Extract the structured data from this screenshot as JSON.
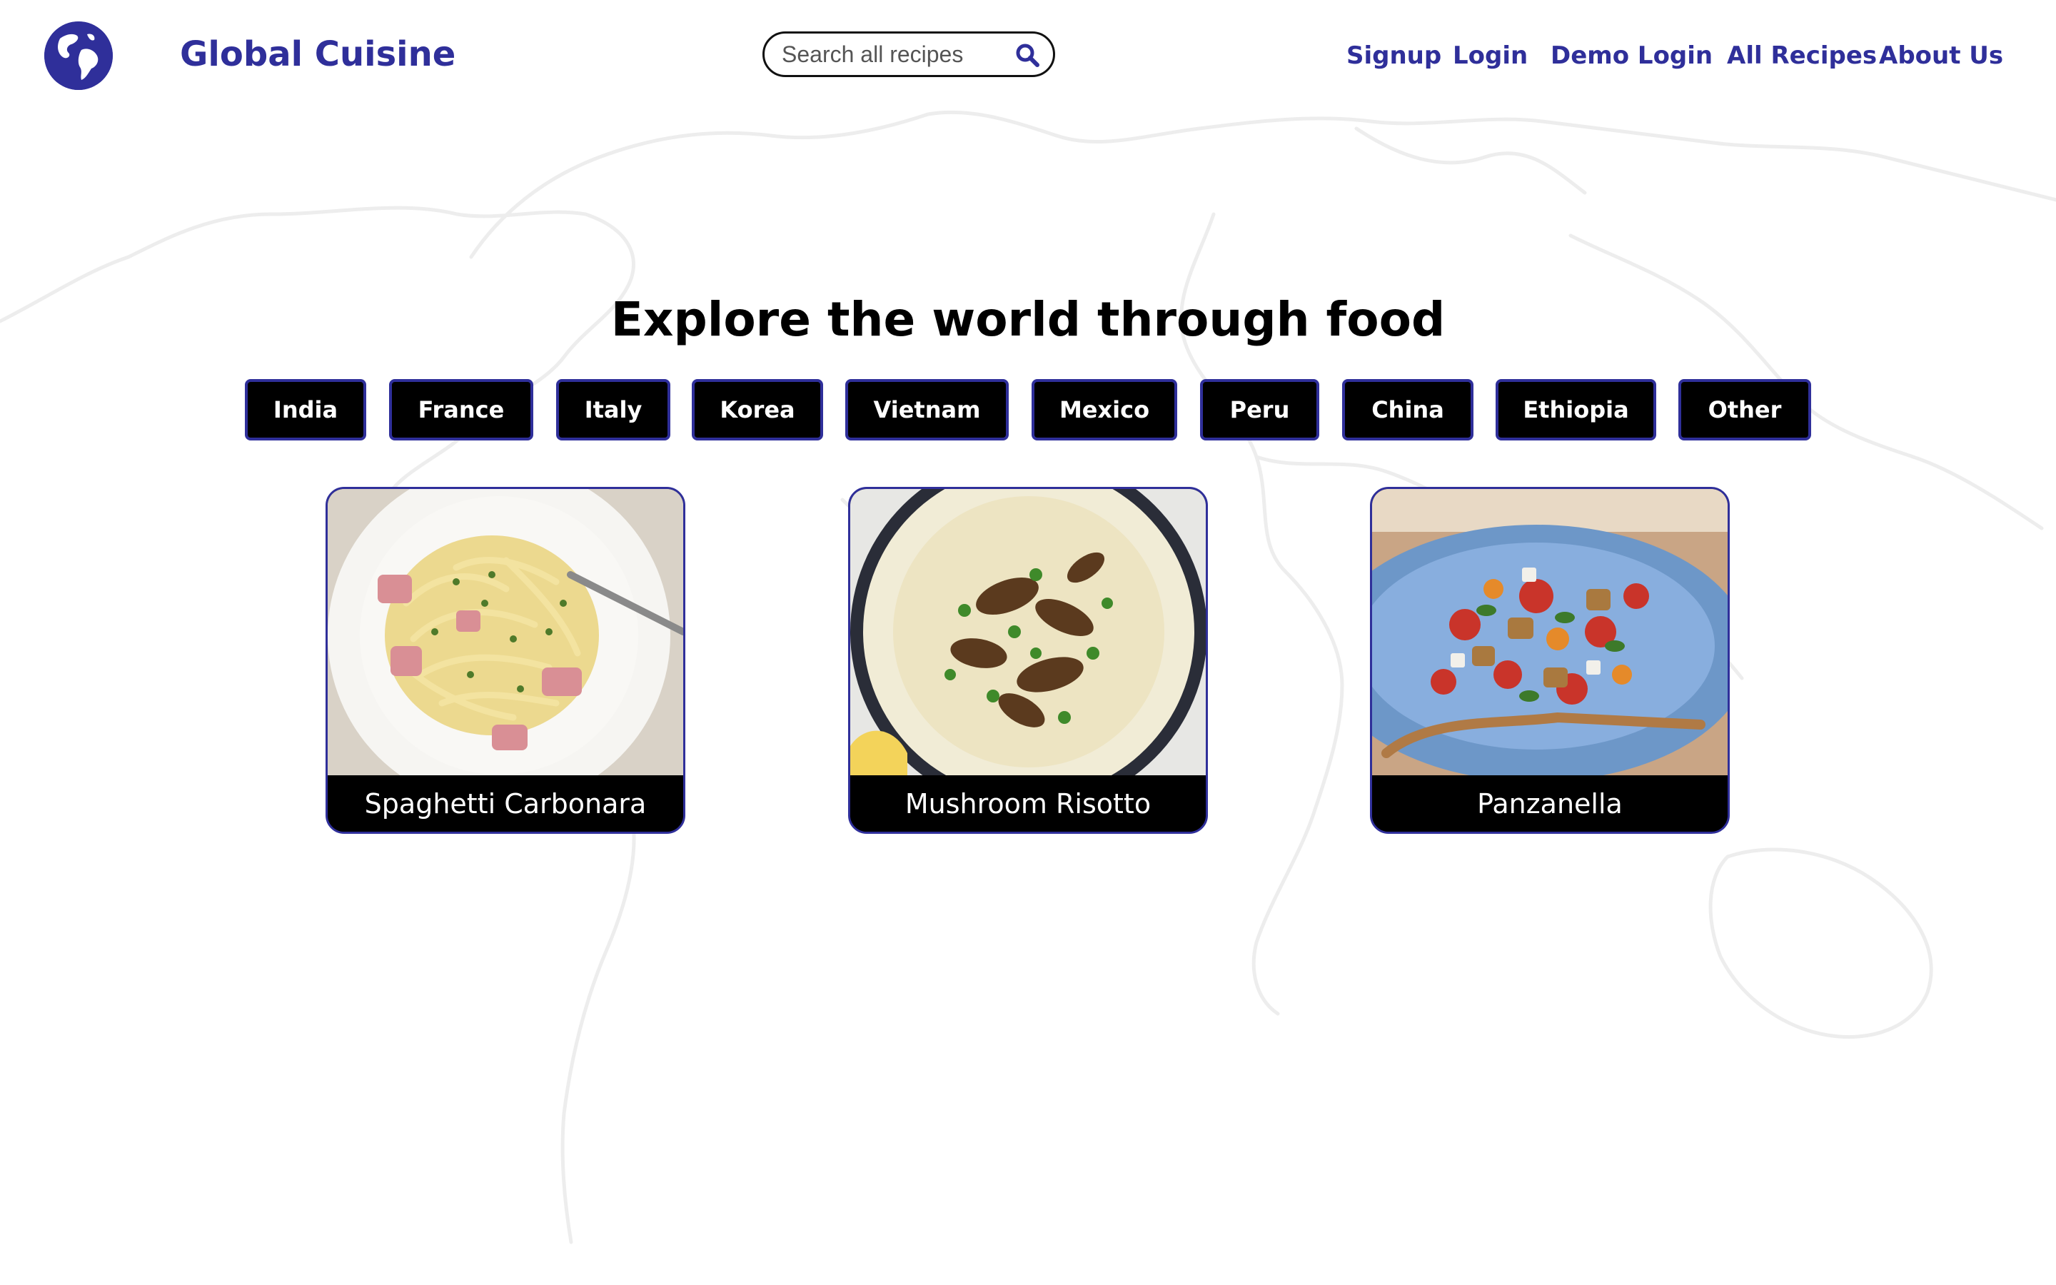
{
  "header": {
    "brand": "Global Cuisine",
    "search": {
      "placeholder": "Search all recipes",
      "value": ""
    },
    "nav": [
      "Signup",
      "Login",
      "Demo Login",
      "All Recipes",
      "About Us"
    ]
  },
  "headline": "Explore the world through food",
  "countries": [
    "India",
    "France",
    "Italy",
    "Korea",
    "Vietnam",
    "Mexico",
    "Peru",
    "China",
    "Ethiopia",
    "Other"
  ],
  "recipes": [
    {
      "name": "Spaghetti Carbonara"
    },
    {
      "name": "Mushroom Risotto"
    },
    {
      "name": "Panzanella"
    }
  ],
  "colors": {
    "brand": "#2f2f9a",
    "button_bg": "#000000",
    "button_text": "#ffffff",
    "map_outline": "#ededed"
  }
}
